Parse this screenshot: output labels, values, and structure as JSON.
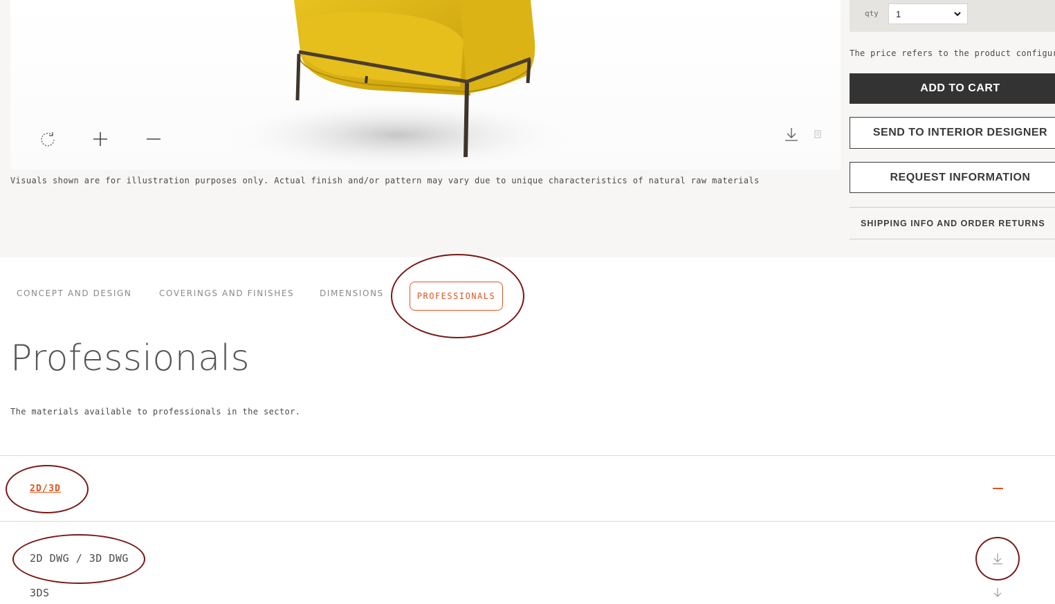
{
  "viewer": {
    "controls": [
      "rotate-icon",
      "zoom-in-icon",
      "zoom-out-icon",
      "download-icon",
      "ar-icon"
    ],
    "disclaimer": "Visuals shown are for illustration purposes only. Actual finish and/or pattern may vary due to unique characteristics of natural raw materials"
  },
  "purchase": {
    "qty_label": "qty",
    "qty_value": "1",
    "price_note": "The price refers to the product configuration",
    "add_to_cart": "ADD TO CART",
    "send_to": "SEND TO INTERIOR DESIGNER",
    "request_info": "REQUEST INFORMATION",
    "shipping": "SHIPPING INFO AND ORDER RETURNS"
  },
  "tabs": [
    {
      "label": "CONCEPT AND DESIGN",
      "active": false
    },
    {
      "label": "COVERINGS AND FINISHES",
      "active": false
    },
    {
      "label": "DIMENSIONS",
      "active": false
    },
    {
      "label": "PROFESSIONALS",
      "active": true
    }
  ],
  "section": {
    "title": "Professionals",
    "subtitle": "The materials available to professionals in the sector."
  },
  "accordion": {
    "heading": "2D/3D",
    "expanded": true,
    "files": [
      {
        "label": "2D DWG / 3D DWG",
        "icon": "download-icon"
      },
      {
        "label": "3DS",
        "icon": "download-icon"
      }
    ]
  },
  "colors": {
    "accent": "#e0531f",
    "annotation": "#7a1818",
    "chair": "#e2b816",
    "dark_button": "#333333"
  }
}
